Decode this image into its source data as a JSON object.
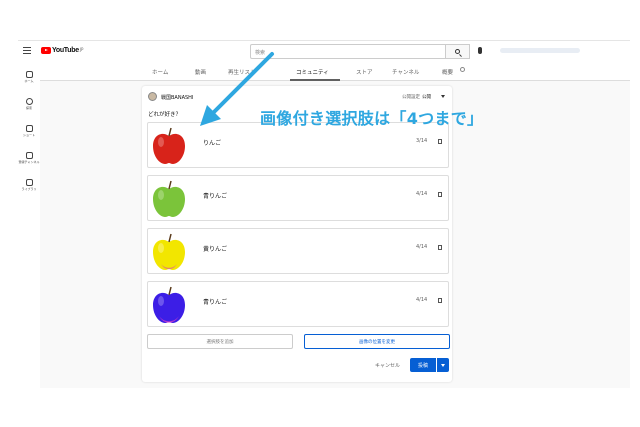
{
  "topbar": {
    "logo": "YouTube",
    "logo_sup": "JP",
    "search_placeholder": "検索"
  },
  "sidebar": {
    "items": [
      {
        "label": "ホーム",
        "icon": "home-icon"
      },
      {
        "label": "探索",
        "icon": "explore-icon"
      },
      {
        "label": "ショート",
        "icon": "shorts-icon"
      },
      {
        "label": "登録チャンネル",
        "icon": "subscriptions-icon"
      },
      {
        "label": "ライブラリ",
        "icon": "library-icon"
      }
    ]
  },
  "tabs": [
    "ホーム",
    "動画",
    "再生リスト",
    "コミュニティ",
    "ストア",
    "チャンネル",
    "概要"
  ],
  "active_tab": "コミュニティ",
  "post": {
    "channel": "戦国BANASHI",
    "visibility_label": "公開設定",
    "visibility_value": "公開",
    "question": "どれが好き？",
    "options": [
      {
        "label": "りんご",
        "count": "3/14",
        "color": "#d8231a"
      },
      {
        "label": "青りんご",
        "count": "4/14",
        "color": "#7bc43a"
      },
      {
        "label": "黄りんご",
        "count": "4/14",
        "color": "#f2e600"
      },
      {
        "label": "青りんご",
        "count": "4/14",
        "color": "#3c1ee6"
      }
    ],
    "add_option": "選択肢を追加",
    "change_order": "画像の位置を変更",
    "cancel": "キャンセル",
    "post": "投稿"
  },
  "annotation": "画像付き選択肢は「4つまで」",
  "colors": {
    "annotation": "#2ea7e0",
    "primary": "#065fd4"
  }
}
